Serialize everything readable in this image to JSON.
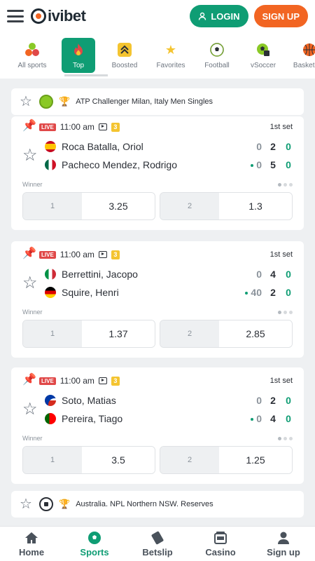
{
  "header": {
    "brand": "ivibet",
    "login_label": "LOGIN",
    "signup_label": "SIGN UP",
    "colors": {
      "primary": "#0f9d74",
      "accent": "#f26522"
    }
  },
  "sports_nav": [
    {
      "label": "All sports",
      "icon": "all-sports-icon"
    },
    {
      "label": "Top",
      "icon": "fire-icon",
      "active": true
    },
    {
      "label": "Boosted",
      "icon": "boosted-icon"
    },
    {
      "label": "Favorites",
      "icon": "star-icon"
    },
    {
      "label": "Football",
      "icon": "football-icon"
    },
    {
      "label": "vSoccer",
      "icon": "vsoccer-icon"
    },
    {
      "label": "Basketball",
      "icon": "basketball-icon"
    }
  ],
  "league1": "ATP Challenger Milan, Italy Men Singles",
  "matches": [
    {
      "live": "LIVE",
      "time": "11:00 am",
      "count": "3",
      "period": "1st set",
      "players": [
        {
          "name": "Roca Batalla, Oriol",
          "flag": "spain",
          "s1": "0",
          "s2": "2",
          "s3": "0",
          "serve": false
        },
        {
          "name": "Pacheco Mendez, Rodrigo",
          "flag": "mexico",
          "s1": "0",
          "s2": "5",
          "s3": "0",
          "serve": true
        }
      ],
      "market": "Winner",
      "odds": [
        {
          "label": "1",
          "value": "3.25"
        },
        {
          "label": "2",
          "value": "1.3"
        }
      ]
    },
    {
      "live": "LIVE",
      "time": "11:00 am",
      "count": "3",
      "period": "1st set",
      "players": [
        {
          "name": "Berrettini, Jacopo",
          "flag": "italy",
          "s1": "0",
          "s2": "4",
          "s3": "0",
          "serve": false
        },
        {
          "name": "Squire, Henri",
          "flag": "germany",
          "s1": "40",
          "s2": "2",
          "s3": "0",
          "serve": true
        }
      ],
      "market": "Winner",
      "odds": [
        {
          "label": "1",
          "value": "1.37"
        },
        {
          "label": "2",
          "value": "2.85"
        }
      ]
    },
    {
      "live": "LIVE",
      "time": "11:00 am",
      "count": "3",
      "period": "1st set",
      "players": [
        {
          "name": "Soto, Matias",
          "flag": "chile",
          "s1": "0",
          "s2": "2",
          "s3": "0",
          "serve": false
        },
        {
          "name": "Pereira, Tiago",
          "flag": "portugal",
          "s1": "0",
          "s2": "4",
          "s3": "0",
          "serve": true
        }
      ],
      "market": "Winner",
      "odds": [
        {
          "label": "1",
          "value": "3.5"
        },
        {
          "label": "2",
          "value": "1.25"
        }
      ]
    }
  ],
  "league2": "Australia. NPL Northern NSW. Reserves",
  "bottom_nav": [
    {
      "label": "Home",
      "icon": "home-icon"
    },
    {
      "label": "Sports",
      "icon": "sports-ball-icon",
      "active": true
    },
    {
      "label": "Betslip",
      "icon": "betslip-icon"
    },
    {
      "label": "Casino",
      "icon": "casino-icon"
    },
    {
      "label": "Sign up",
      "icon": "user-icon"
    }
  ]
}
